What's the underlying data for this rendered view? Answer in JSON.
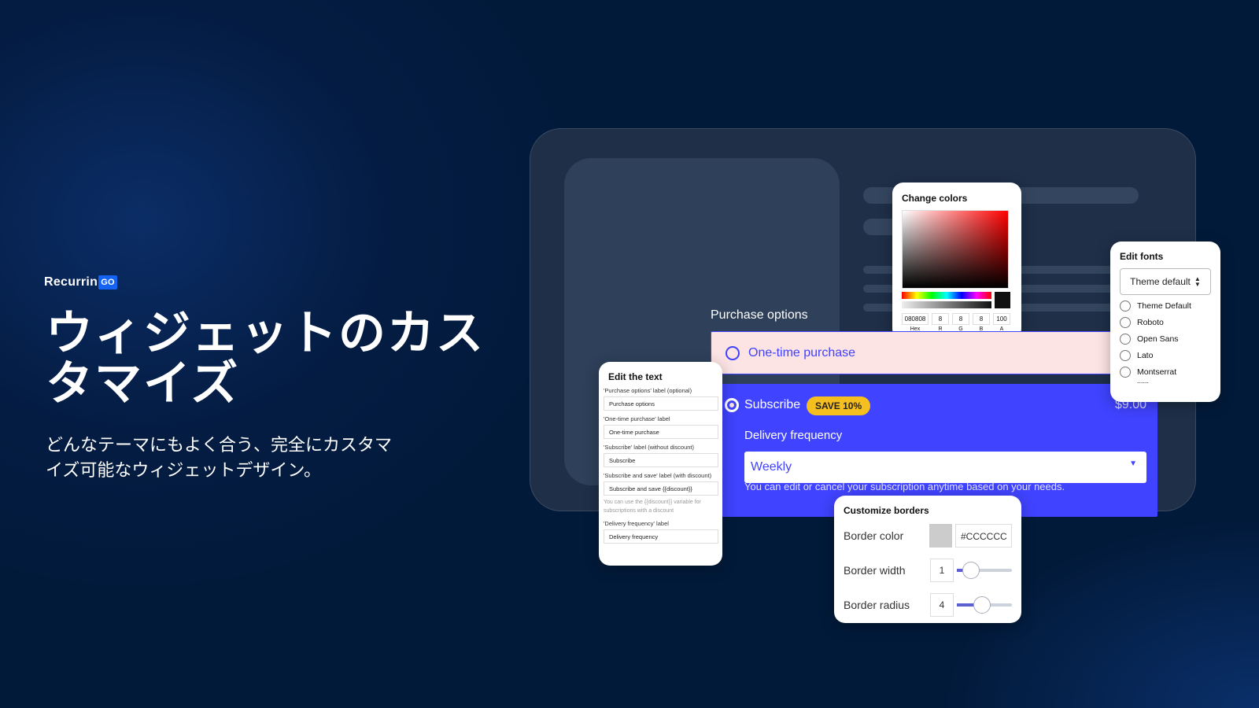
{
  "brand": {
    "logo_text": "Recurrin",
    "logo_badge": "GO"
  },
  "hero": {
    "title": "ウィジェットのカスタマイズ",
    "subtitle": "どんなテーマにもよく合う、完全にカスタマイズ可能なウィジェットデザイン。"
  },
  "widget": {
    "purchase_options_label": "Purchase options",
    "one_time_label": "One-time purchase",
    "subscribe_label": "Subscribe",
    "save_badge": "SAVE 10%",
    "price": "$9.00",
    "delivery_label": "Delivery frequency",
    "delivery_value": "Weekly",
    "note": "You can edit or cancel your subscription anytime based on your needs.",
    "colors": {
      "accent": "#4043ff",
      "one_time_bg": "#fde4e4",
      "badge": "#f5bf1f"
    }
  },
  "edit_text": {
    "title": "Edit the text",
    "fields": [
      {
        "label": "'Purchase options' label (optional)",
        "value": "Purchase options"
      },
      {
        "label": "'One-time purchase' label",
        "value": "One-time purchase"
      },
      {
        "label": "'Subscribe' label (without discount)",
        "value": "Subscribe"
      },
      {
        "label": "'Subscribe and save' label (with discount)",
        "value": "Subscribe and save {{discount}}"
      },
      {
        "label": "'Delivery frequency' label",
        "value": "Delivery frequency"
      }
    ],
    "hint": "You can use the {{discount}} variable for subscriptions with a discount"
  },
  "change_colors": {
    "title": "Change colors",
    "hex": "080808",
    "r": "8",
    "g": "8",
    "b": "8",
    "a": "100",
    "labels": [
      "Hex",
      "R",
      "G",
      "B",
      "A"
    ]
  },
  "edit_fonts": {
    "title": "Edit fonts",
    "selected": "Theme default",
    "options": [
      "Theme Default",
      "Roboto",
      "Open Sans",
      "Lato",
      "Montserrat"
    ],
    "more": "......"
  },
  "borders": {
    "title": "Customize borders",
    "color_label": "Border color",
    "color_value": "#CCCCCC",
    "width_label": "Border width",
    "width_value": "1",
    "radius_label": "Border radius",
    "radius_value": "4",
    "width_level": 0.1,
    "radius_level": 0.3
  }
}
